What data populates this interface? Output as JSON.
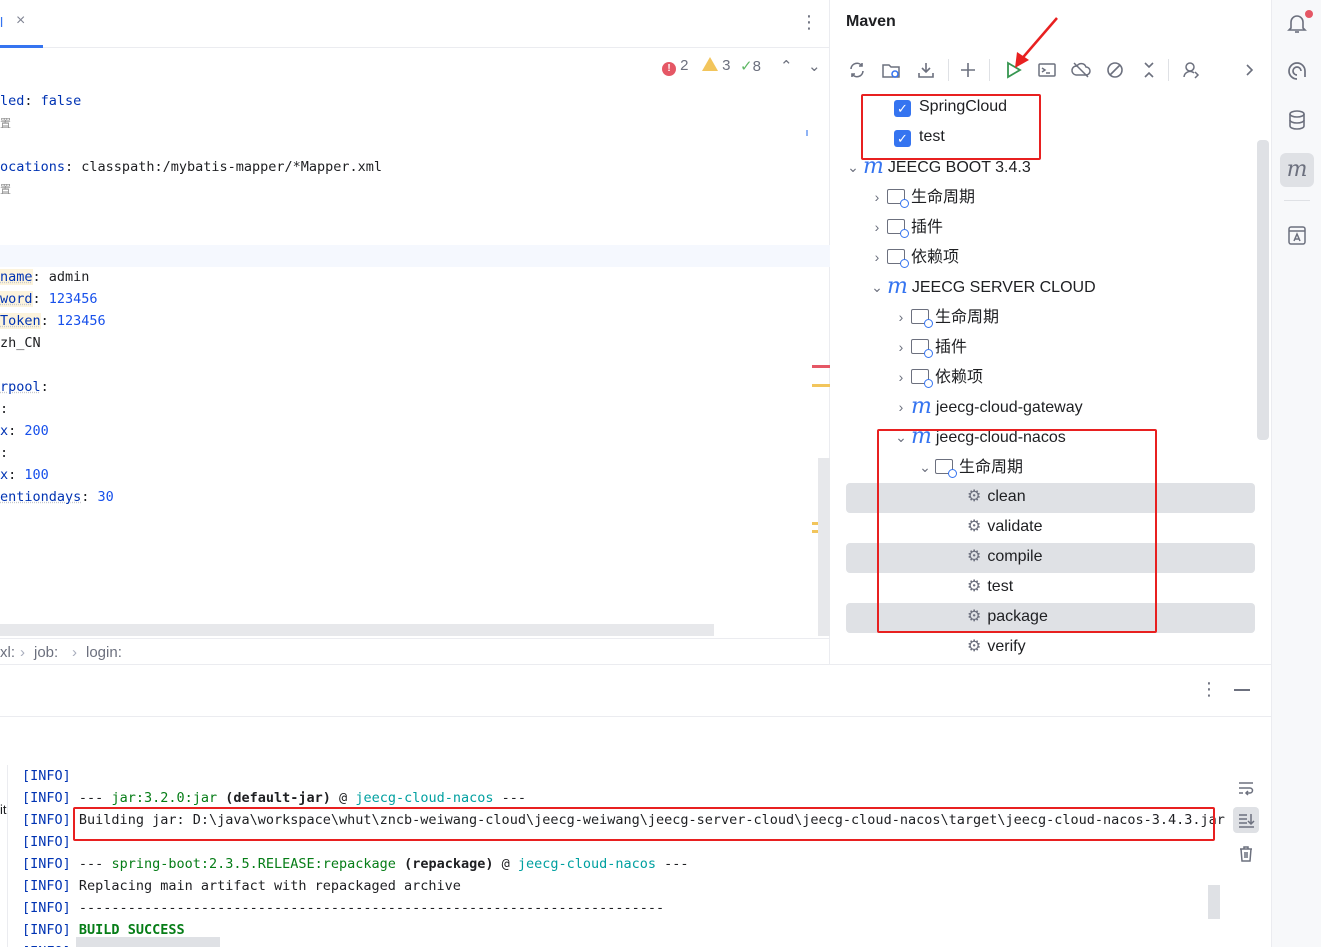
{
  "editor": {
    "tab_label": "l",
    "tab_close": "×",
    "more_icon": "⋮",
    "inspections": {
      "errors": "2",
      "warnings": "3",
      "weak": "8"
    },
    "code_lines": [
      {
        "key": "led",
        "sep": ": ",
        "val": "false",
        "type": "kw"
      },
      {
        "key": "置",
        "sep": "",
        "val": "",
        "type": "comment"
      },
      {
        "key": "",
        "sep": "",
        "val": "",
        "type": "blank"
      },
      {
        "key": "ocations",
        "sep": ": ",
        "val": "classpath:/mybatis-mapper/*Mapper.xml",
        "type": "plain"
      },
      {
        "key": "置",
        "sep": "",
        "val": "",
        "type": "comment"
      },
      {
        "key": "",
        "sep": "",
        "val": "",
        "type": "blank"
      },
      {
        "key": "",
        "sep": "",
        "val": "",
        "type": "blank"
      },
      {
        "key": "",
        "sep": "",
        "val": "",
        "type": "blank"
      },
      {
        "key": "name",
        "sep": ": ",
        "val": "admin",
        "type": "plain"
      },
      {
        "key": "word",
        "sep": ": ",
        "val": "123456",
        "type": "plain"
      },
      {
        "key": "Token",
        "sep": ": ",
        "val": "123456",
        "type": "plain"
      },
      {
        "key": "zh_CN",
        "sep": "",
        "val": "",
        "type": "bare"
      },
      {
        "key": "",
        "sep": "",
        "val": "",
        "type": "blank"
      },
      {
        "key": "rpool",
        "sep": ":",
        "val": "",
        "type": "plain"
      },
      {
        "key": "",
        "sep": ":",
        "val": "",
        "type": "plain"
      },
      {
        "key": "x",
        "sep": ": ",
        "val": "200",
        "type": "plain"
      },
      {
        "key": "",
        "sep": ":",
        "val": "",
        "type": "plain"
      },
      {
        "key": "x",
        "sep": ": ",
        "val": "100",
        "type": "plain"
      },
      {
        "key": "entiondays",
        "sep": ": ",
        "val": "30",
        "type": "plain"
      }
    ],
    "breadcrumb": [
      "xl:",
      "job:",
      "login:"
    ]
  },
  "maven": {
    "title": "Maven",
    "toolbar": [
      {
        "icon": "reload-icon"
      },
      {
        "icon": "generate-sources-icon"
      },
      {
        "icon": "download-icon"
      },
      {
        "icon": "add-icon"
      },
      {
        "icon": "run-icon"
      },
      {
        "icon": "execute-goal-icon"
      },
      {
        "icon": "offline-icon"
      },
      {
        "icon": "skip-tests-icon"
      },
      {
        "icon": "collapse-icon"
      },
      {
        "icon": "profiles-icon"
      },
      {
        "icon": "more-icon"
      }
    ],
    "tree": {
      "profiles": [
        "SpringCloud",
        "test"
      ],
      "root": "JEECG BOOT 3.4.3",
      "root_children": [
        "生命周期",
        "插件",
        "依赖项"
      ],
      "server": "JEECG SERVER CLOUD",
      "server_children": [
        "生命周期",
        "插件",
        "依赖项"
      ],
      "gateway": "jeecg-cloud-gateway",
      "nacos": "jeecg-cloud-nacos",
      "lifecycle": "生命周期",
      "goals": [
        "clean",
        "validate",
        "compile",
        "test",
        "package",
        "verify"
      ]
    }
  },
  "console": {
    "more_icon": "⋮",
    "gutter_label": "it",
    "lines": [
      {
        "tag": "[INFO]",
        "parts": []
      },
      {
        "tag": "[INFO]",
        "parts": [
          [
            "p",
            "--- "
          ],
          [
            "g",
            "jar:3.2.0:jar"
          ],
          [
            "p",
            " "
          ],
          [
            "b",
            "(default-jar)"
          ],
          [
            "p",
            " @ "
          ],
          [
            "t",
            "jeecg-cloud-nacos"
          ],
          [
            "p",
            " ---"
          ]
        ]
      },
      {
        "tag": "[INFO]",
        "parts": [
          [
            "p",
            "Building jar: D:\\java\\workspace\\whut\\zncb-weiwang-cloud\\jeecg-weiwang\\jeecg-server-cloud\\jeecg-cloud-nacos\\target\\jeecg-cloud-nacos-3.4.3.jar"
          ]
        ]
      },
      {
        "tag": "[INFO]",
        "parts": []
      },
      {
        "tag": "[INFO]",
        "parts": [
          [
            "p",
            "--- "
          ],
          [
            "g",
            "spring-boot:2.3.5.RELEASE:repackage"
          ],
          [
            "p",
            " "
          ],
          [
            "b",
            "(repackage)"
          ],
          [
            "p",
            " @ "
          ],
          [
            "t",
            "jeecg-cloud-nacos"
          ],
          [
            "p",
            " ---"
          ]
        ]
      },
      {
        "tag": "[INFO]",
        "parts": [
          [
            "p",
            "Replacing main artifact with repackaged archive"
          ]
        ]
      },
      {
        "tag": "[INFO]",
        "parts": [
          [
            "p",
            "------------------------------------------------------------------------"
          ]
        ]
      },
      {
        "tag": "[INFO]",
        "parts": [
          [
            "s",
            "BUILD SUCCESS"
          ]
        ]
      },
      {
        "tag": "[INFO]",
        "parts": []
      }
    ]
  },
  "colors": {
    "accent": "#3574f0",
    "annotation_red": "#e82020",
    "success": "#067d17"
  }
}
